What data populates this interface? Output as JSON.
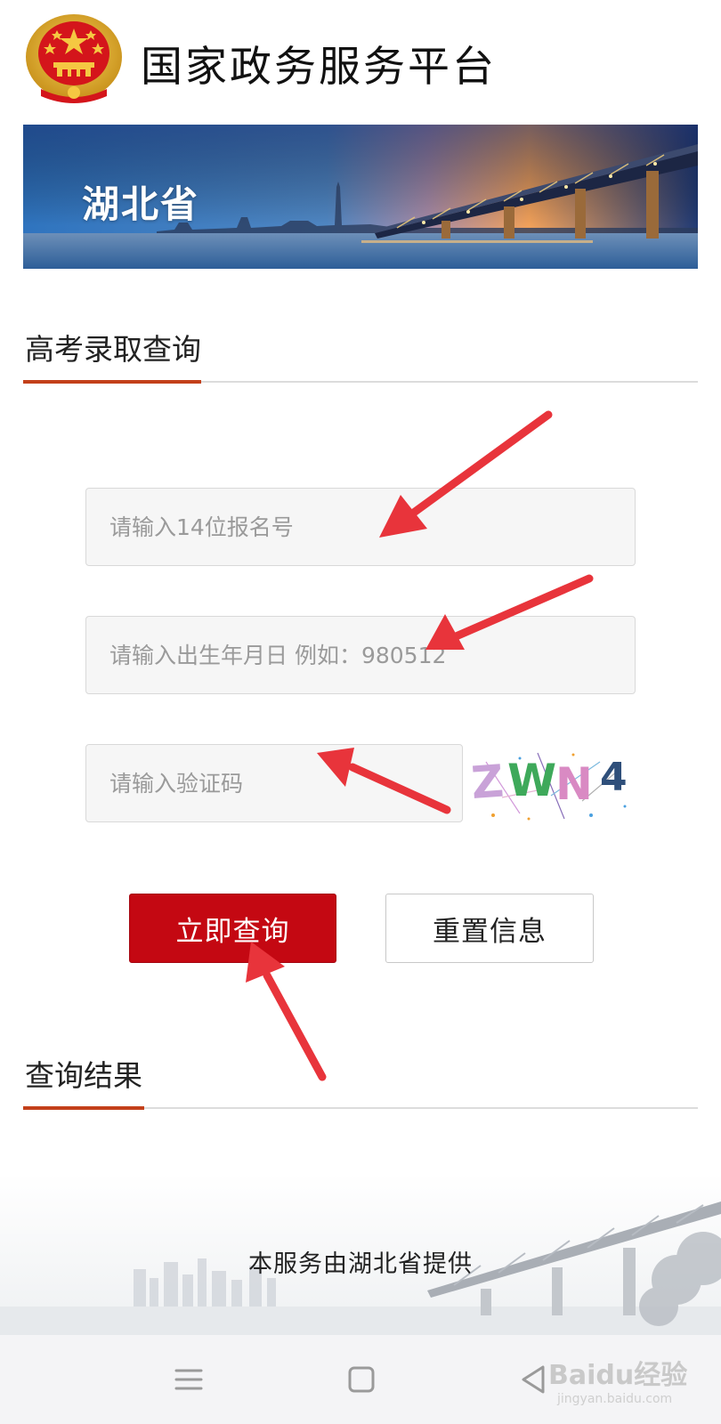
{
  "header": {
    "title": "国家政务服务平台",
    "emblem_icon": "national-emblem-icon"
  },
  "banner": {
    "province": "湖北省"
  },
  "query_section": {
    "title": "高考录取查询",
    "registration_placeholder": "请输入14位报名号",
    "birthdate_placeholder": "请输入出生年月日 例如：980512",
    "captcha_placeholder": "请输入验证码",
    "captcha_text": "ZWN4",
    "submit_label": "立即查询",
    "reset_label": "重置信息"
  },
  "result_section": {
    "title": "查询结果"
  },
  "footer": {
    "note": "本服务由湖北省提供"
  },
  "navbar": {
    "menu_icon": "menu-icon",
    "home_icon": "square-home-icon",
    "back_icon": "triangle-back-icon"
  },
  "watermark": {
    "brand": "Baidu经验",
    "url": "jingyan.baidu.com"
  },
  "colors": {
    "accent": "#c3401a",
    "primary_button": "#c40812"
  }
}
